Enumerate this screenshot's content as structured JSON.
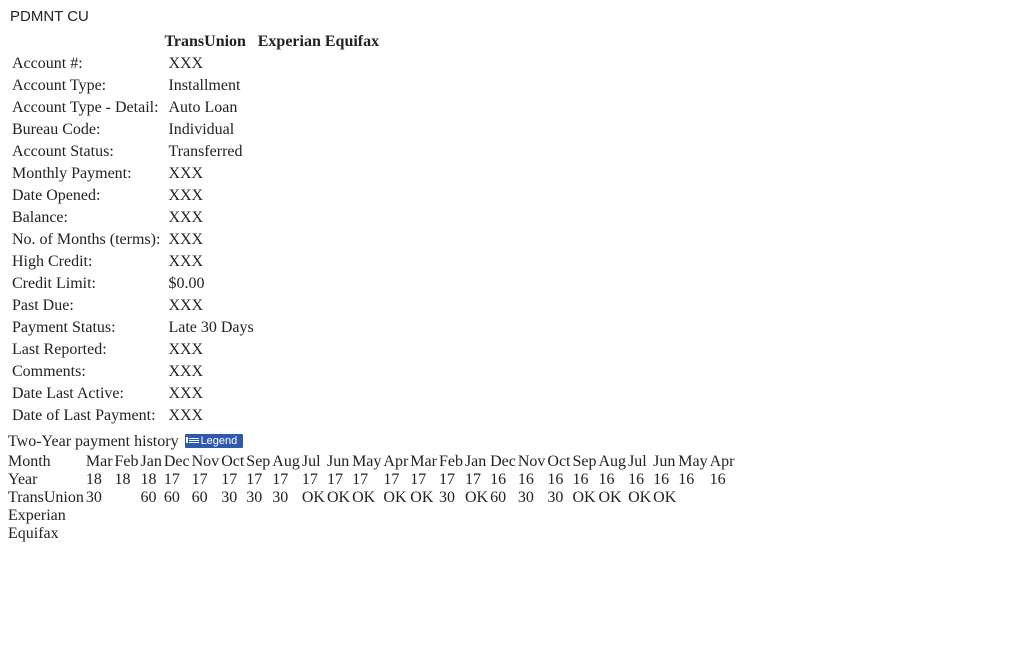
{
  "creditor": "PDMNT CU",
  "bureauHeaders": [
    "TransUnion",
    "Experian",
    "Equifax"
  ],
  "detailRows": [
    {
      "label": "Account #:",
      "tu": "XXX",
      "ex": "",
      "eq": ""
    },
    {
      "label": "Account Type:",
      "tu": "Installment",
      "ex": "",
      "eq": ""
    },
    {
      "label": "Account Type - Detail:",
      "tu": "Auto Loan",
      "ex": "",
      "eq": ""
    },
    {
      "label": "Bureau Code:",
      "tu": "Individual",
      "ex": "",
      "eq": ""
    },
    {
      "label": "Account Status:",
      "tu": "Transferred",
      "ex": "",
      "eq": ""
    },
    {
      "label": "Monthly Payment:",
      "tu": "XXX",
      "ex": "",
      "eq": ""
    },
    {
      "label": "Date Opened:",
      "tu": "XXX",
      "ex": "",
      "eq": ""
    },
    {
      "label": "Balance:",
      "tu": "XXX",
      "ex": "",
      "eq": ""
    },
    {
      "label": "No. of Months (terms):",
      "tu": "XXX",
      "ex": "",
      "eq": ""
    },
    {
      "label": "High Credit:",
      "tu": "XXX",
      "ex": "",
      "eq": ""
    },
    {
      "label": "Credit Limit:",
      "tu": "$0.00",
      "ex": "",
      "eq": ""
    },
    {
      "label": "Past Due:",
      "tu": "XXX",
      "ex": "",
      "eq": ""
    },
    {
      "label": "Payment Status:",
      "tu": "Late 30 Days",
      "ex": "",
      "eq": ""
    },
    {
      "label": "Last Reported:",
      "tu": "XXX",
      "ex": "",
      "eq": ""
    },
    {
      "label": "Comments:",
      "tu": "XXX",
      "ex": "",
      "eq": ""
    },
    {
      "label": "Date Last Active:",
      "tu": "XXX",
      "ex": "",
      "eq": ""
    },
    {
      "label": "Date of Last Payment:",
      "tu": "XXX",
      "ex": "",
      "eq": ""
    }
  ],
  "history": {
    "title": "Two-Year payment history",
    "legendLabel": "Legend",
    "rowLabels": {
      "month": "Month",
      "year": "Year"
    },
    "bureauRowLabels": [
      "TransUnion",
      "Experian",
      "Equifax"
    ],
    "months": [
      "Mar",
      "Feb",
      "Jan",
      "Dec",
      "Nov",
      "Oct",
      "Sep",
      "Aug",
      "Jul",
      "Jun",
      "May",
      "Apr",
      "Mar",
      "Feb",
      "Jan",
      "Dec",
      "Nov",
      "Oct",
      "Sep",
      "Aug",
      "Jul",
      "Jun",
      "May",
      "Apr"
    ],
    "years": [
      "18",
      "18",
      "18",
      "17",
      "17",
      "17",
      "17",
      "17",
      "17",
      "17",
      "17",
      "17",
      "17",
      "17",
      "17",
      "16",
      "16",
      "16",
      "16",
      "16",
      "16",
      "16",
      "16",
      "16"
    ],
    "transunion": [
      "30",
      "",
      "60",
      "60",
      "60",
      "30",
      "30",
      "30",
      "OK",
      "OK",
      "OK",
      "OK",
      "OK",
      "30",
      "OK",
      "60",
      "30",
      "30",
      "OK",
      "OK",
      "OK",
      "OK",
      "",
      ""
    ],
    "experian": [
      "",
      "",
      "",
      "",
      "",
      "",
      "",
      "",
      "",
      "",
      "",
      "",
      "",
      "",
      "",
      "",
      "",
      "",
      "",
      "",
      "",
      "",
      "",
      ""
    ],
    "equifax": [
      "",
      "",
      "",
      "",
      "",
      "",
      "",
      "",
      "",
      "",
      "",
      "",
      "",
      "",
      "",
      "",
      "",
      "",
      "",
      "",
      "",
      "",
      "",
      ""
    ]
  }
}
